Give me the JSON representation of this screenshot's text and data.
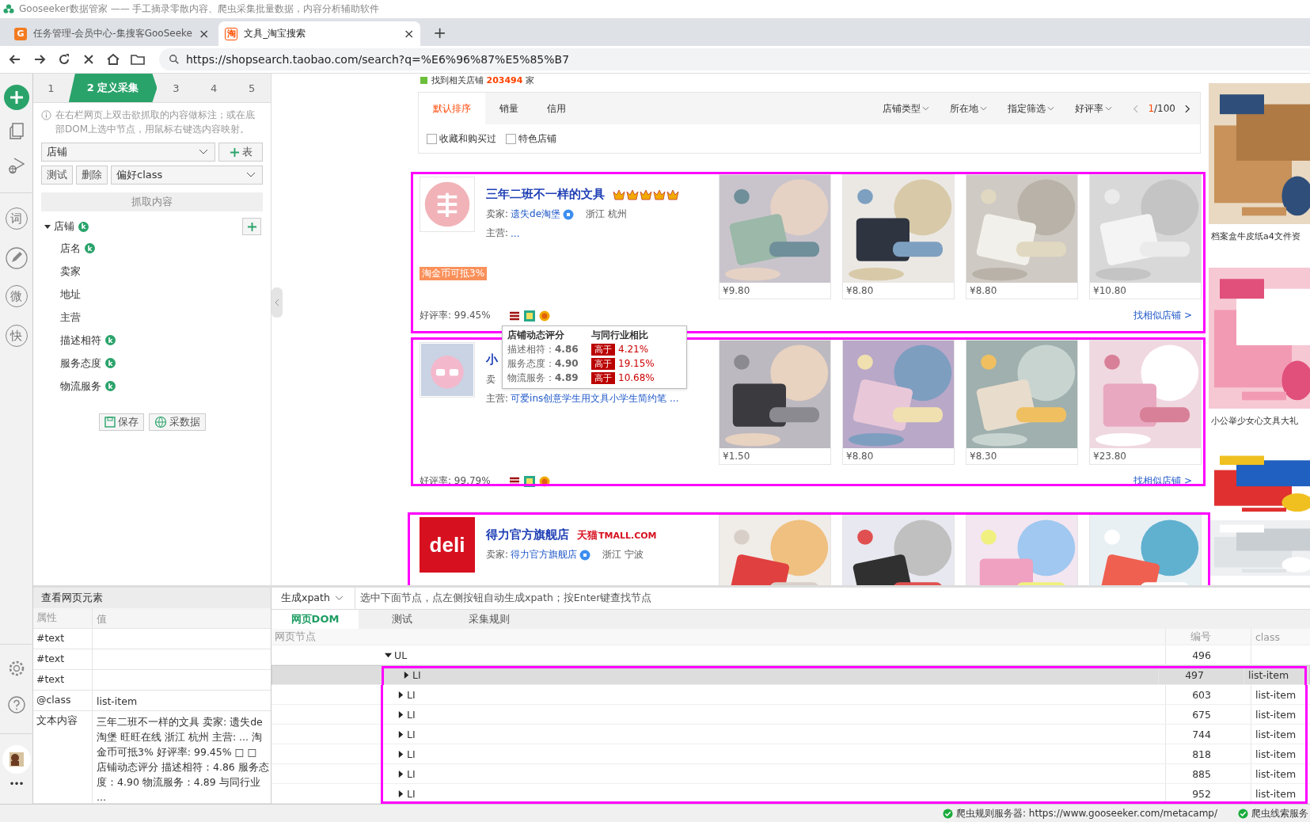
{
  "app_title": "Gooseeker数据管家 —— 手工摘录零散内容、爬虫采集批量数据，内容分析辅助软件",
  "browser_tabs": [
    {
      "icon_text": "G",
      "title": "任务管理-会员中心-集搜客GooSeeke",
      "close": "×",
      "selected": false,
      "kind": "letter"
    },
    {
      "icon_text": "淘",
      "title": "文具_淘宝搜索",
      "close": "×",
      "selected": true,
      "kind": "taobao"
    }
  ],
  "new_tab": "+",
  "address": "https://shopsearch.taobao.com/search?q=%E6%96%87%E5%85%B7",
  "rail_tools": [
    {
      "kind": "char",
      "text": "词"
    },
    {
      "kind": "pencil"
    },
    {
      "kind": "char",
      "text": "微"
    },
    {
      "kind": "char",
      "text": "快"
    }
  ],
  "rail_more": "•••",
  "steps": [
    {
      "label": "1",
      "selected": false
    },
    {
      "label": "2 定义采集",
      "selected": true
    },
    {
      "label": "3",
      "selected": false
    },
    {
      "label": "4",
      "selected": false
    },
    {
      "label": "5",
      "selected": false
    }
  ],
  "hint": "在右栏网页上双击欲抓取的内容做标注；或在底部DOM上选中节点，用鼠标右键选内容映射。",
  "table_select": "店铺",
  "add_table_label": "表",
  "test_button": "测试",
  "delete_button": "删除",
  "class_select": "偏好class",
  "grab_button": "抓取内容",
  "tree": {
    "label": "店铺",
    "badge": "k",
    "expanded": true,
    "children": [
      {
        "label": "店名",
        "badge": "k"
      },
      {
        "label": "卖家"
      },
      {
        "label": "地址"
      },
      {
        "label": "主营"
      },
      {
        "label": "描述相符",
        "badge": "k"
      },
      {
        "label": "服务态度",
        "badge": "k"
      },
      {
        "label": "物流服务",
        "badge": "k"
      }
    ]
  },
  "save_button": "保存",
  "collect_button": "采数据",
  "page": {
    "result_prefix": "找到相关店铺",
    "result_count": "203494",
    "result_suffix": "家",
    "sort_tabs": [
      {
        "label": "默认排序",
        "selected": true
      },
      {
        "label": "销量",
        "selected": false
      },
      {
        "label": "信用",
        "selected": false
      }
    ],
    "filters": [
      "店铺类型",
      "所在地",
      "指定筛选",
      "好评率"
    ],
    "pager": {
      "current": "1",
      "total": "/100"
    },
    "checkboxes": [
      {
        "label": "收藏和购买过",
        "checked": false
      },
      {
        "label": "特色店铺",
        "checked": false
      }
    ],
    "shops": [
      {
        "name": "三年二班不一样的文具",
        "kind": "crown",
        "stars": 5,
        "seller_label": "卖家:",
        "seller": "遗失de淘堡",
        "location": "浙江 杭州",
        "main_label": "主营:",
        "main": "...",
        "coupon": "淘金币可抵3%",
        "rating": "好评率: 99.45%",
        "similar": "找相似店铺 >",
        "highlighted": true,
        "tooltip": {
          "header": [
            "店铺动态评分",
            "与同行业相比"
          ],
          "rows": [
            {
              "label": "描述相符：",
              "score": "4.86",
              "tag": "高于",
              "diff": "4.21%"
            },
            {
              "label": "服务态度：",
              "score": "4.90",
              "tag": "高于",
              "diff": "19.15%"
            },
            {
              "label": "物流服务：",
              "score": "4.89",
              "tag": "高于",
              "diff": "10.68%"
            }
          ]
        },
        "products": [
          {
            "kind": "picture",
            "price": "¥9.80"
          },
          {
            "kind": "picture",
            "price": "¥8.80"
          },
          {
            "kind": "picture",
            "price": "¥8.80"
          },
          {
            "kind": "picture",
            "price": "¥10.80"
          }
        ]
      },
      {
        "name": "小",
        "kind": "plain",
        "seller_label": "卖",
        "main_label": "主营:",
        "main": "可爱ins创意学生用文具小学生简约笔 ...",
        "rating": "好评率: 99.79%",
        "similar": "找相似店铺 >",
        "highlighted": true,
        "products": [
          {
            "kind": "picture",
            "price": "¥1.50"
          },
          {
            "kind": "picture",
            "price": "¥8.80"
          },
          {
            "kind": "picture",
            "price": "¥8.30"
          },
          {
            "kind": "picture",
            "price": "¥23.80"
          }
        ]
      },
      {
        "name": "得力官方旗舰店",
        "kind": "tmall",
        "mall_logo": "天猫",
        "mall_logo_latin": "TMALL.COM",
        "logo_text": "deli",
        "seller_label": "卖家:",
        "seller": "得力官方旗舰店",
        "location": "浙江 宁波",
        "highlighted": true,
        "products": [
          {
            "kind": "picture"
          },
          {
            "kind": "picture"
          },
          {
            "kind": "picture"
          },
          {
            "kind": "picture"
          }
        ]
      }
    ],
    "ads": [
      {
        "kind": "picture",
        "caption": "档案盒牛皮纸a4文件资"
      },
      {
        "kind": "picture",
        "caption": "小公举少女心文具大礼"
      },
      {
        "kind": "picture"
      },
      {
        "kind": "picture"
      }
    ]
  },
  "element_viewer": {
    "title": "查看网页元素",
    "columns": [
      "属性",
      "值"
    ],
    "rows": [
      {
        "attribute": "#text"
      },
      {
        "attribute": "#text"
      },
      {
        "attribute": "#text"
      },
      {
        "attribute": "@class",
        "value": "list-item"
      },
      {
        "attribute": "文本内容",
        "value": "三年二班不一样的文具 卖家: 遗失de淘堡 旺旺在线 浙江 杭州 主营: ... 淘金币可抵3% 好评率: 99.45% □ □ 店铺动态评分 描述相符：4.86 服务态度：4.90 物流服务：4.89 与同行业 ..."
      }
    ]
  },
  "dom_panel": {
    "xpath_select": "生成xpath",
    "hint": "选中下面节点，点左侧按钮自动生成xpath；按Enter键查找节点",
    "tabs": [
      {
        "label": "网页DOM",
        "selected": true
      },
      {
        "label": "测试",
        "selected": false
      },
      {
        "label": "采集规则",
        "selected": false
      }
    ],
    "columns": [
      "网页节点",
      "编号",
      "class"
    ],
    "nodes": [
      {
        "tag": "UL",
        "number": "496",
        "expanded": true,
        "selected": false,
        "children": [
          {
            "tag": "LI",
            "number": "497",
            "class": "list-item",
            "expanded": false,
            "selected": true,
            "highlighted": true
          },
          {
            "tag": "LI",
            "number": "603",
            "class": "list-item",
            "expanded": false,
            "selected": false,
            "highlighted": true
          },
          {
            "tag": "LI",
            "number": "675",
            "class": "list-item",
            "expanded": false,
            "selected": false,
            "highlighted": true
          },
          {
            "tag": "LI",
            "number": "744",
            "class": "list-item",
            "expanded": false,
            "selected": false,
            "highlighted": true
          },
          {
            "tag": "LI",
            "number": "818",
            "class": "list-item",
            "expanded": false,
            "selected": false,
            "highlighted": true
          },
          {
            "tag": "LI",
            "number": "885",
            "class": "list-item",
            "expanded": false,
            "selected": false,
            "highlighted": true
          },
          {
            "tag": "LI",
            "number": "952",
            "class": "list-item",
            "expanded": false,
            "selected": false,
            "highlighted": true
          }
        ]
      }
    ]
  },
  "status_bar": [
    {
      "text": "爬虫规则服务器: https://www.gooseeker.com/metacamp/",
      "ok": true
    },
    {
      "text": "爬虫线索服务",
      "ok": true
    }
  ]
}
